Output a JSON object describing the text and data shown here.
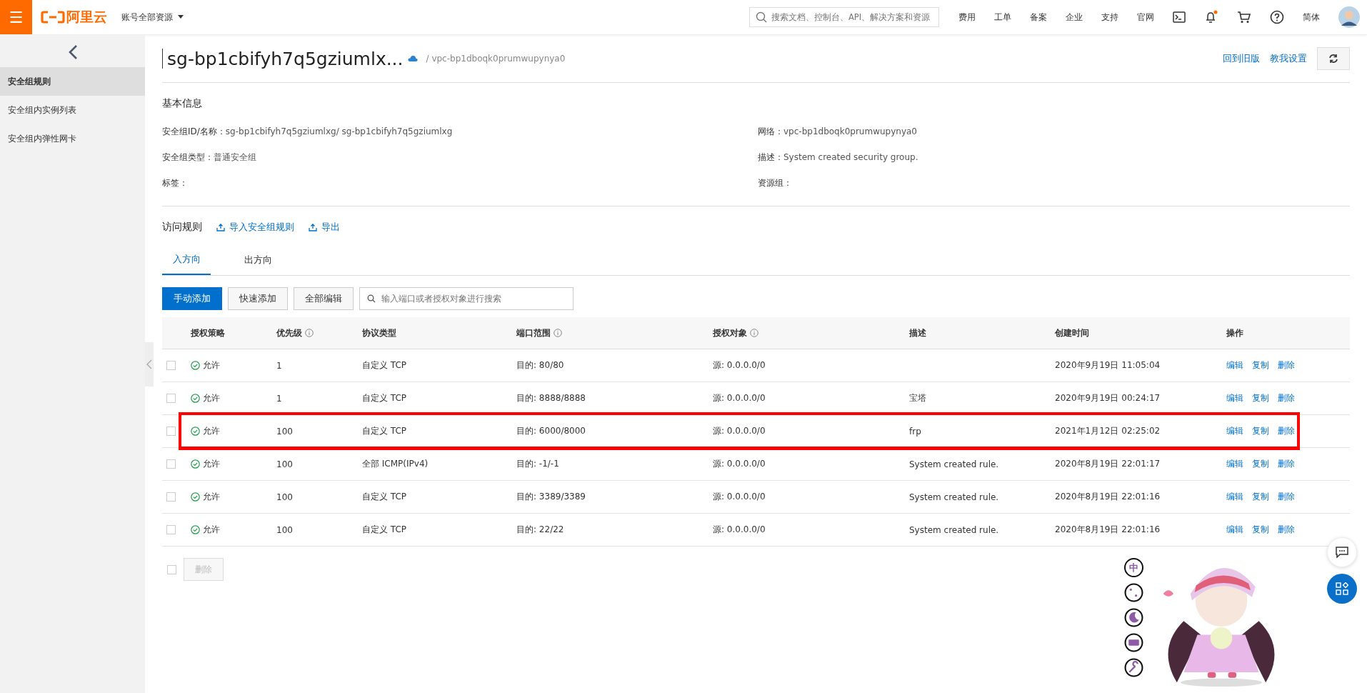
{
  "topbar": {
    "menu_glyph": "☰",
    "logo_text": "阿里云",
    "account": "账号全部资源",
    "search": {
      "placeholder": "搜索文档、控制台、API、解决方案和资源"
    },
    "nav": [
      "费用",
      "工单",
      "备案",
      "企业",
      "支持",
      "官网"
    ],
    "language": "简体",
    "notification_dot": true
  },
  "sidebar": {
    "items": [
      {
        "label": "安全组规则",
        "selected": true
      },
      {
        "label": "安全组内实例列表",
        "selected": false
      },
      {
        "label": "安全组内弹性网卡",
        "selected": false
      }
    ]
  },
  "header": {
    "title": "sg-bp1cbifyh7q5gziumlx...",
    "subtitle": "/ vpc-bp1dboqk0prumwupynya0",
    "links": [
      "回到旧版",
      "教我设置"
    ]
  },
  "basic_info": {
    "title": "基本信息",
    "fields": [
      {
        "label": "安全组ID/名称：",
        "value": "sg-bp1cbifyh7q5gziumlxg/ sg-bp1cbifyh7q5gziumlxg"
      },
      {
        "label": "网络：",
        "value": "vpc-bp1dboqk0prumwupynya0"
      },
      {
        "label": "安全组类型：",
        "value": "普通安全组"
      },
      {
        "label": "描述：",
        "value": "System created security group."
      },
      {
        "label": "标签："
      },
      {
        "label": "资源组："
      }
    ]
  },
  "rules": {
    "title": "访问规则",
    "actions": [
      "导入安全组规则",
      "导出"
    ],
    "tabs": [
      {
        "label": "入方向",
        "selected": true
      },
      {
        "label": "出方向",
        "selected": false
      }
    ],
    "buttons": [
      {
        "label": "手动添加",
        "kind": "primary"
      },
      {
        "label": "快速添加",
        "kind": "default"
      },
      {
        "label": "全部编辑",
        "kind": "default"
      }
    ],
    "search": {
      "placeholder": "输入端口或者授权对象进行搜索"
    },
    "table": {
      "columns": [
        {
          "label": "授权策略",
          "info": false
        },
        {
          "label": "优先级",
          "info": true
        },
        {
          "label": "协议类型",
          "info": false
        },
        {
          "label": "端口范围",
          "info": true
        },
        {
          "label": "授权对象",
          "info": true
        },
        {
          "label": "描述",
          "info": false
        },
        {
          "label": "创建时间",
          "info": false
        },
        {
          "label": "操作",
          "info": false
        }
      ],
      "rows": [
        {
          "checked": false,
          "highlighted": false,
          "policy": "允许",
          "priority": "1",
          "protocol": "自定义 TCP",
          "port": "目的: 80/80",
          "source": "源: 0.0.0.0/0",
          "created": "2020年9月19日 11:05:04",
          "ops": [
            "编辑",
            "复制",
            "删除"
          ]
        },
        {
          "checked": false,
          "highlighted": false,
          "policy": "允许",
          "priority": "1",
          "protocol": "自定义 TCP",
          "port": "目的: 8888/8888",
          "source": "源: 0.0.0.0/0",
          "description": "宝塔",
          "created": "2020年9月19日 00:24:17",
          "ops": [
            "编辑",
            "复制",
            "删除"
          ]
        },
        {
          "checked": false,
          "highlighted": true,
          "policy": "允许",
          "priority": "100",
          "protocol": "自定义 TCP",
          "port": "目的: 6000/8000",
          "source": "源: 0.0.0.0/0",
          "description": "frp",
          "created": "2021年1月12日 02:25:02",
          "ops": [
            "编辑",
            "复制",
            "删除"
          ]
        },
        {
          "checked": false,
          "highlighted": false,
          "policy": "允许",
          "priority": "100",
          "protocol": "全部 ICMP(IPv4)",
          "port": "目的: -1/-1",
          "source": "源: 0.0.0.0/0",
          "description": "System created rule.",
          "created": "2020年8月19日 22:01:17",
          "ops": [
            "编辑",
            "复制",
            "删除"
          ]
        },
        {
          "checked": false,
          "highlighted": false,
          "policy": "允许",
          "priority": "100",
          "protocol": "自定义 TCP",
          "port": "目的: 3389/3389",
          "source": "源: 0.0.0.0/0",
          "description": "System created rule.",
          "created": "2020年8月19日 22:01:16",
          "ops": [
            "编辑",
            "复制",
            "删除"
          ]
        },
        {
          "checked": false,
          "highlighted": false,
          "policy": "允许",
          "priority": "100",
          "protocol": "自定义 TCP",
          "port": "目的: 22/22",
          "source": "源: 0.0.0.0/0",
          "description": "System created rule.",
          "created": "2020年8月19日 22:01:16",
          "ops": [
            "编辑",
            "复制",
            "删除"
          ]
        }
      ]
    },
    "footer": {
      "select_all_checked": false,
      "delete_label": "删除",
      "delete_disabled": true
    }
  },
  "ime_toolbar": {
    "mode_glyph": "中"
  }
}
